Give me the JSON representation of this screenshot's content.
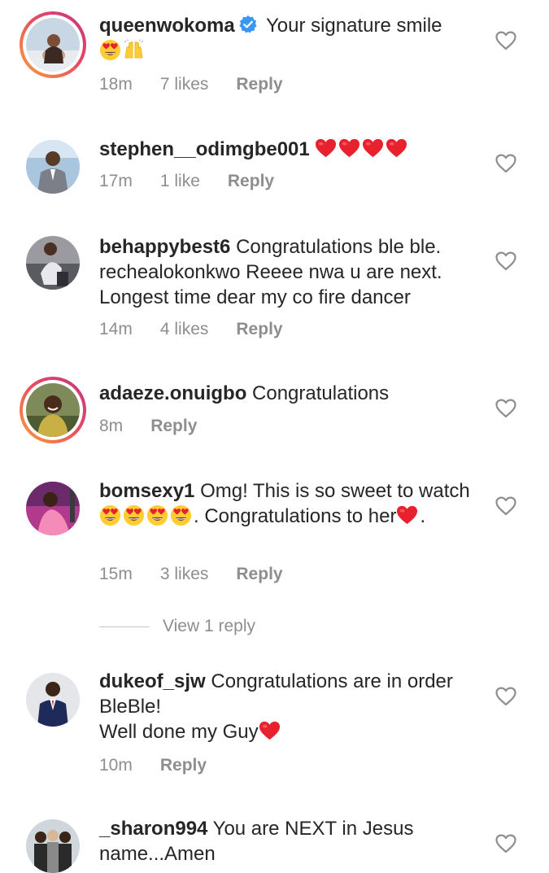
{
  "comments": [
    {
      "username": "queenwokoma",
      "verified": true,
      "text": "Your signature smile",
      "emojis": [
        "heart-eyes",
        "raised-hands"
      ],
      "time": "18m",
      "likes": "7 likes",
      "reply": "Reply"
    },
    {
      "username": "stephen__odimgbe001",
      "text": "",
      "emojis": [
        "red-heart",
        "red-heart",
        "red-heart",
        "red-heart"
      ],
      "time": "17m",
      "likes": "1 like",
      "reply": "Reply"
    },
    {
      "username": "behappybest6",
      "text": "Congratulations ble ble. rechealokonkwo Reeee nwa u are next. Longest time dear my co fire dancer",
      "time": "14m",
      "likes": "4 likes",
      "reply": "Reply"
    },
    {
      "username": "adaeze.onuigbo",
      "text": "Congratulations",
      "time": "8m",
      "likes": "",
      "reply": "Reply"
    },
    {
      "username": "bomsexy1",
      "text_a": "Omg! This is so sweet to watch",
      "text_b": ". Congratulations to her",
      "text_c": ".",
      "time": "15m",
      "likes": "3 likes",
      "reply": "Reply",
      "view_replies": "View 1 reply"
    },
    {
      "username": "dukeof_sjw",
      "text_a": "Congratulations are in order BleBle!",
      "text_b": "Well done my Guy",
      "time": "10m",
      "likes": "",
      "reply": "Reply"
    },
    {
      "username": "_sharon994",
      "text": "You are NEXT in Jesus name...Amen"
    }
  ],
  "colors": {
    "text": "#262626",
    "secondary": "#8e8e8e",
    "verified": "#3897f0",
    "heart": "#e0245e",
    "story_ring": [
      "#f9a13a",
      "#e94a61",
      "#c13584"
    ]
  }
}
